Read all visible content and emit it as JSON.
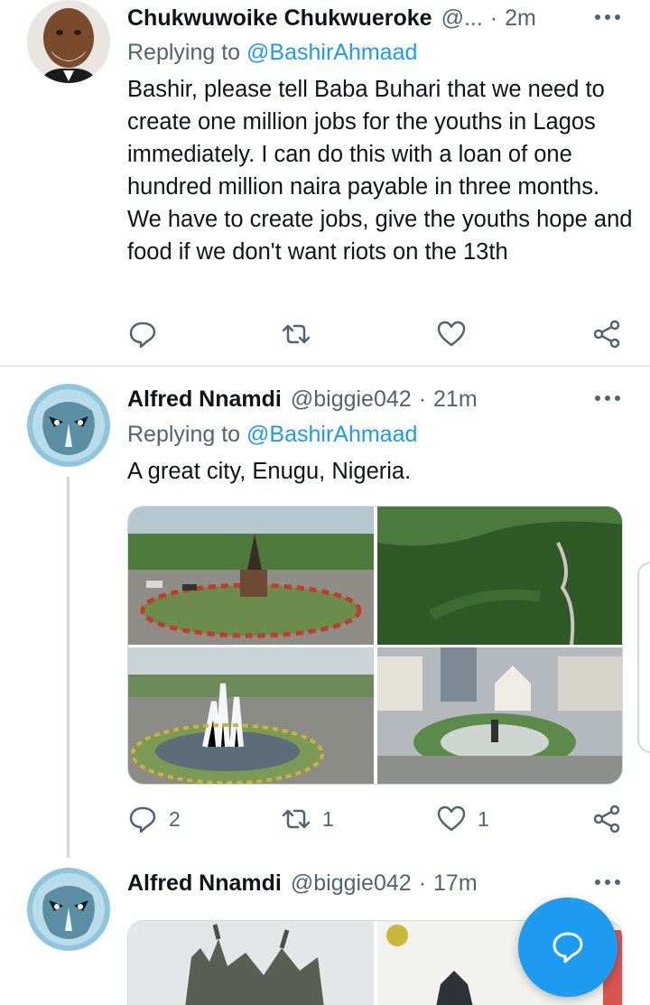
{
  "tweets": [
    {
      "name": "Chukwuwoike Chukwueroke",
      "handle": "@...",
      "separator": "·",
      "time": "2m",
      "reply_prefix": "Replying to ",
      "reply_mention": "@BashirAhmaad",
      "text": "Bashir, please tell Baba Buhari that we need to create one million jobs for the youths in Lagos immediately. I can do this with a loan of one hundred million naira payable in three months. We have to create jobs, give the youths hope and food if we don't want riots on the 13th",
      "actions": {
        "reply_count": "",
        "retweet_count": "",
        "like_count": ""
      }
    },
    {
      "name": "Alfred Nnamdi",
      "handle": "@biggie042",
      "separator": "·",
      "time": "21m",
      "reply_prefix": "Replying to ",
      "reply_mention": "@BashirAhmaad",
      "text": "A great city, Enugu, Nigeria.",
      "media_count": 4,
      "actions": {
        "reply_count": "2",
        "retweet_count": "1",
        "like_count": "1"
      }
    },
    {
      "name": "Alfred Nnamdi",
      "handle": "@biggie042",
      "separator": "·",
      "time": "17m",
      "media_count": 2
    }
  ],
  "icons": {
    "reply": "reply-icon",
    "retweet": "retweet-icon",
    "like": "heart-icon",
    "share": "share-icon",
    "more": "more-icon",
    "compose": "compose-reply-icon"
  },
  "colors": {
    "accent": "#1d9bf0",
    "text_primary": "#0f1419",
    "text_secondary": "#536471",
    "divider": "#cfd9de"
  }
}
